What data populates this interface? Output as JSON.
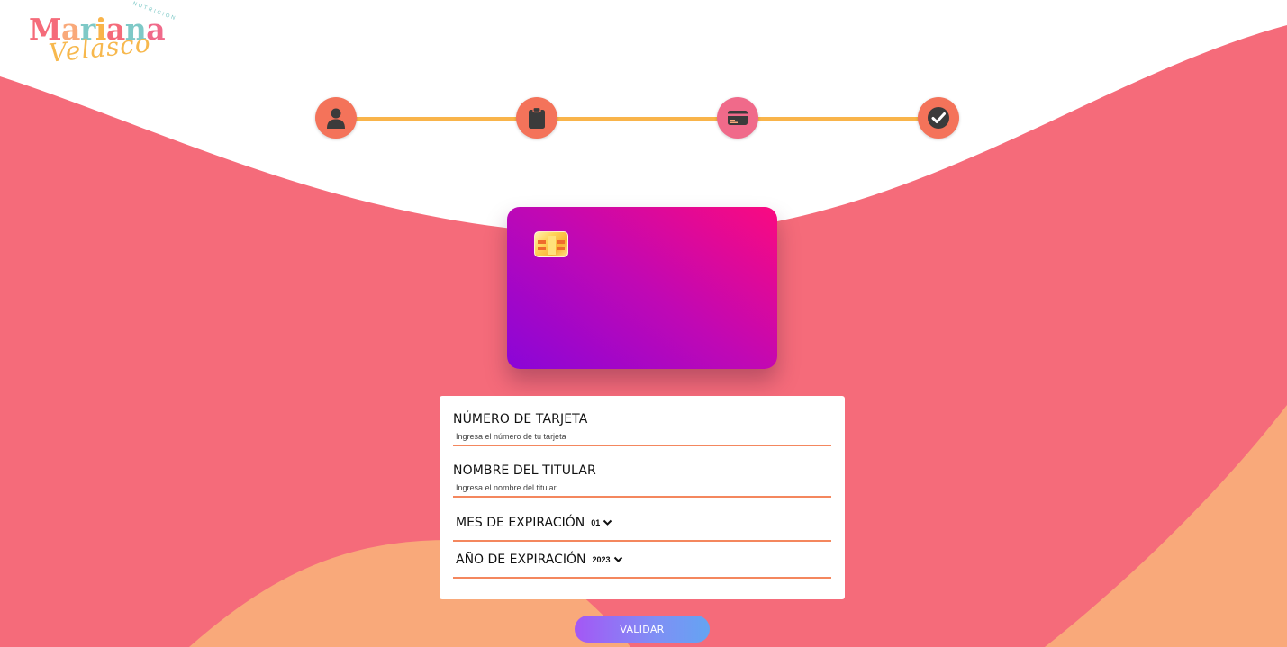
{
  "brand": {
    "main": "Mariana",
    "script": "Velasco",
    "small": "NUTRICIÓN"
  },
  "stepper": {
    "steps": [
      {
        "icon": "user-icon",
        "state": "complete"
      },
      {
        "icon": "clipboard-icon",
        "state": "complete"
      },
      {
        "icon": "credit-card-icon",
        "state": "current"
      },
      {
        "icon": "check-circle-icon",
        "state": "pending"
      }
    ]
  },
  "form": {
    "card_number": {
      "label": "NÚMERO DE TARJETA",
      "placeholder": "Ingresa el número de tu tarjeta"
    },
    "holder_name": {
      "label": "NOMBRE DEL TITULAR",
      "placeholder": "Ingresa el nombre del titular"
    },
    "exp_month": {
      "label": "MES DE EXPIRACIÓN",
      "value": "01"
    },
    "exp_year": {
      "label": "AÑO DE EXPIRACIÓN",
      "value": "2023"
    }
  },
  "actions": {
    "validate_label": "VALIDAR"
  },
  "colors": {
    "coral": "#f4735a",
    "pink_bg": "#f56b7a",
    "peach": "#f9a97a",
    "accent_line": "#f9b44a",
    "card_gradient_start": "#8a05d8",
    "card_gradient_end": "#fa0a80"
  }
}
